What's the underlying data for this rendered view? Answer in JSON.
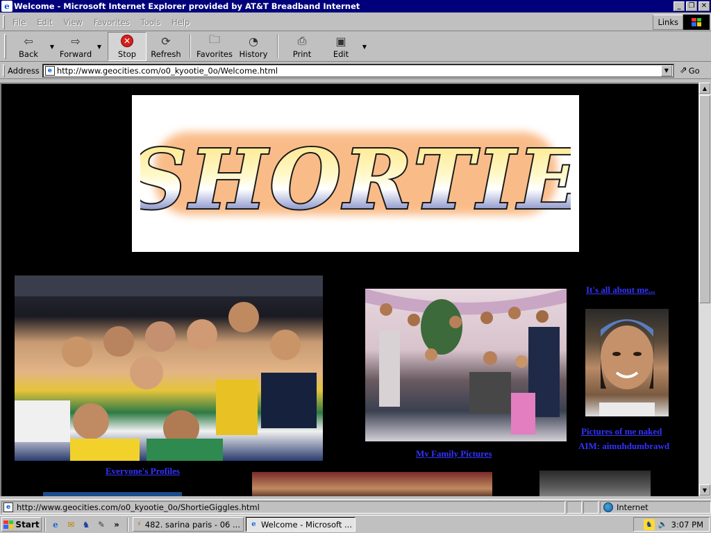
{
  "window": {
    "title": "Welcome - Microsoft Internet Explorer provided by AT&T Breadband Internet",
    "controls": {
      "minimize": "_",
      "maximize": "❐",
      "close": "✕"
    }
  },
  "menu": {
    "items": [
      "File",
      "Edit",
      "View",
      "Favorites",
      "Tools",
      "Help"
    ],
    "links_label": "Links"
  },
  "toolbar": {
    "back": "Back",
    "forward": "Forward",
    "stop": "Stop",
    "refresh": "Refresh",
    "favorites": "Favorites",
    "history": "History",
    "print": "Print",
    "edit": "Edit"
  },
  "address": {
    "label": "Address",
    "url": "http://www.geocities.com/o0_kyootie_0o/Welcome.html",
    "go_label": "Go"
  },
  "page": {
    "banner_text": "SHORTIE",
    "links": {
      "about_me": "It's all about me...",
      "profiles": "Everyone's Profiles",
      "family": "My Family Pictures",
      "pictures": "Pictures of me naked"
    },
    "aim": "AIM: aimuhdumbrawd"
  },
  "status": {
    "text": "http://www.geocities.com/o0_kyootie_0o/ShortieGiggles.html",
    "zone": "Internet"
  },
  "taskbar": {
    "start": "Start",
    "quicklaunch_more": "»",
    "tasks": [
      "482. sarina paris - 06 ...",
      "Welcome - Microsoft ..."
    ],
    "clock": "3:07 PM"
  }
}
